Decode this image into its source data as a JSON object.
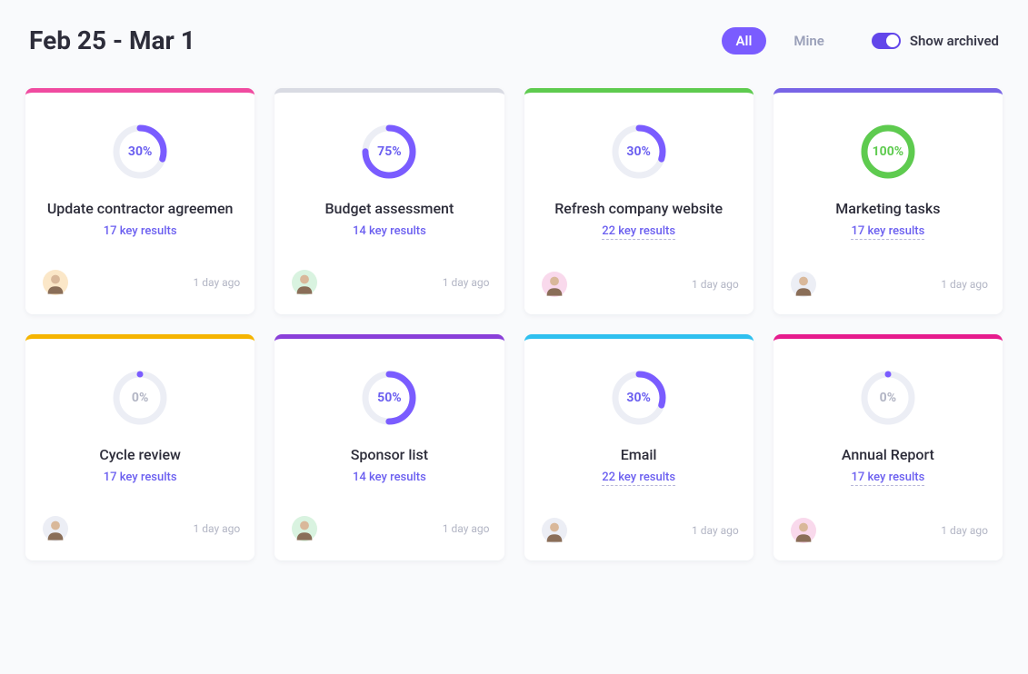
{
  "header": {
    "title": "Feb 25 - Mar 1",
    "filter_all": "All",
    "filter_mine": "Mine",
    "toggle_label": "Show archived",
    "toggle_on": true
  },
  "colors": {
    "purple": "#7a5cff",
    "green": "#5ecb4f",
    "pink": "#f04ba0",
    "gray": "#d9dbe3",
    "border_green": "#5ecb4f",
    "border_violet": "#7864e6",
    "border_amber": "#f5b400",
    "border_purple": "#8a3fd9",
    "border_cyan": "#2fc0ef",
    "border_magenta": "#e61b8d"
  },
  "cards": [
    {
      "title": "Update contractor agreemen",
      "sub": "17 key results",
      "sub_linked": false,
      "pct": 30,
      "pct_label": "30%",
      "ring_color": "#7a5cff",
      "pct_color": "#6b5ff0",
      "border": "#f04ba0",
      "avatar_bg": "#fbe7c8",
      "avatar_emoji": "person-1",
      "timestamp": "1 day ago"
    },
    {
      "title": "Budget assessment",
      "sub": "14 key results",
      "sub_linked": false,
      "pct": 75,
      "pct_label": "75%",
      "ring_color": "#7a5cff",
      "pct_color": "#6b5ff0",
      "border": "#d9dbe3",
      "avatar_bg": "#d9f3e0",
      "avatar_emoji": "person-2",
      "timestamp": "1 day ago"
    },
    {
      "title": "Refresh company website",
      "sub": "22 key results",
      "sub_linked": true,
      "pct": 30,
      "pct_label": "30%",
      "ring_color": "#7a5cff",
      "pct_color": "#6b5ff0",
      "border": "#5ecb4f",
      "avatar_bg": "#f9d9ec",
      "avatar_emoji": "person-3",
      "timestamp": "1 day ago"
    },
    {
      "title": "Marketing tasks",
      "sub": "17 key results",
      "sub_linked": true,
      "pct": 100,
      "pct_label": "100%",
      "ring_color": "#5ecb4f",
      "pct_color": "#5ecb4f",
      "border": "#7864e6",
      "avatar_bg": "#eceef5",
      "avatar_emoji": "person-4",
      "timestamp": "1 day ago"
    },
    {
      "title": "Cycle review",
      "sub": "17 key results",
      "sub_linked": false,
      "pct": 0,
      "pct_label": "0%",
      "ring_color": "#7a5cff",
      "pct_color": "#b2b5c4",
      "border": "#f5b400",
      "avatar_bg": "#eceef5",
      "avatar_emoji": "person-5",
      "timestamp": "1 day ago"
    },
    {
      "title": "Sponsor list",
      "sub": "14 key results",
      "sub_linked": false,
      "pct": 50,
      "pct_label": "50%",
      "ring_color": "#7a5cff",
      "pct_color": "#6b5ff0",
      "border": "#8a3fd9",
      "avatar_bg": "#d9f3e0",
      "avatar_emoji": "person-6",
      "timestamp": "1 day ago"
    },
    {
      "title": "Email",
      "sub": "22 key results",
      "sub_linked": true,
      "pct": 30,
      "pct_label": "30%",
      "ring_color": "#7a5cff",
      "pct_color": "#6b5ff0",
      "border": "#2fc0ef",
      "avatar_bg": "#eceef5",
      "avatar_emoji": "person-7",
      "timestamp": "1 day ago"
    },
    {
      "title": "Annual Report",
      "sub": "17 key results",
      "sub_linked": true,
      "pct": 0,
      "pct_label": "0%",
      "ring_color": "#7a5cff",
      "pct_color": "#b2b5c4",
      "border": "#e61b8d",
      "avatar_bg": "#f9d9ec",
      "avatar_emoji": "person-8",
      "timestamp": "1 day ago"
    }
  ]
}
